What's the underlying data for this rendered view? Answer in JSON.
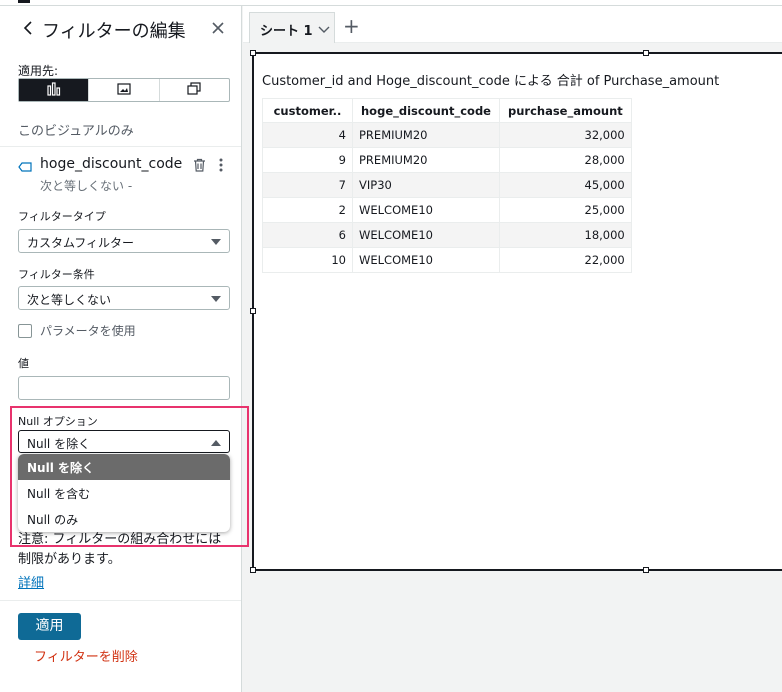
{
  "panel": {
    "title": "フィルターの編集",
    "apply_to_label": "適用先:",
    "scope_text": "このビジュアルのみ",
    "field": {
      "name": "hoge_discount_code",
      "summary": "次と等しくない -"
    },
    "filter_type": {
      "label": "フィルタータイプ",
      "value": "カスタムフィルター"
    },
    "filter_condition": {
      "label": "フィルター条件",
      "value": "次と等しくない"
    },
    "use_parameter_label": "パラメータを使用",
    "value_label": "値",
    "value_input": "",
    "null_option": {
      "label": "Null オプション",
      "selected": "Null を除く",
      "options": [
        "Null を除く",
        "Null を含む",
        "Null のみ"
      ]
    },
    "note_text": "注意: フィルターの組み合わせには制限があります。",
    "note_link": "詳細",
    "apply_button": "適用",
    "delete_link": "フィルターを削除"
  },
  "tabs": {
    "sheet_label": "シート 1",
    "add_icon": "+"
  },
  "visual": {
    "title": "Customer_id and Hoge_discount_code による 合計 of Purchase_amount",
    "columns": [
      "customer..",
      "hoge_discount_code",
      "purchase_amount"
    ],
    "rows": [
      [
        "4",
        "PREMIUM20",
        "32,000"
      ],
      [
        "9",
        "PREMIUM20",
        "28,000"
      ],
      [
        "7",
        "VIP30",
        "45,000"
      ],
      [
        "2",
        "WELCOME10",
        "25,000"
      ],
      [
        "6",
        "WELCOME10",
        "18,000"
      ],
      [
        "10",
        "WELCOME10",
        "22,000"
      ]
    ]
  },
  "colors": {
    "highlight_border": "#e8336d",
    "primary_button": "#0f6a96",
    "link": "#0073bb",
    "danger": "#d13212"
  },
  "icons": [
    "back-chevron-icon",
    "close-icon",
    "bar-chart-icon",
    "image-icon",
    "copy-icon",
    "tag-icon",
    "trash-icon",
    "more-vertical-icon",
    "chevron-down-icon",
    "plus-icon"
  ]
}
